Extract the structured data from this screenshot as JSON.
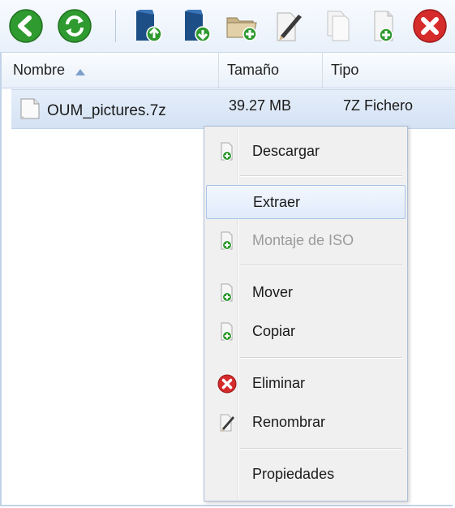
{
  "toolbar": {
    "buttons": [
      {
        "name": "back-button",
        "icon": "back-arrow-icon"
      },
      {
        "name": "refresh-button",
        "icon": "refresh-icon"
      },
      {
        "name": "upload-button",
        "icon": "upload-icon"
      },
      {
        "name": "download-button",
        "icon": "download-icon"
      },
      {
        "name": "new-folder-button",
        "icon": "new-folder-icon"
      },
      {
        "name": "rename-button",
        "icon": "rename-icon"
      },
      {
        "name": "copy-button",
        "icon": "copy-icon"
      },
      {
        "name": "new-file-button",
        "icon": "new-file-icon"
      },
      {
        "name": "delete-button",
        "icon": "delete-icon"
      }
    ]
  },
  "grid": {
    "columns": {
      "name": "Nombre",
      "size": "Tamaño",
      "type": "Tipo"
    },
    "sort_indicator": "ascending",
    "rows": [
      {
        "name": "OUM_pictures.7z",
        "size": "39.27 MB",
        "type": "7Z Fichero",
        "selected": true
      }
    ]
  },
  "context_menu": {
    "items": [
      {
        "label": "Descargar",
        "icon": "download-file-icon",
        "enabled": true
      },
      {
        "label": "Extraer",
        "icon": "",
        "enabled": true,
        "hovered": true
      },
      {
        "label": "Montaje de ISO",
        "icon": "mount-file-icon",
        "enabled": false
      },
      {
        "label": "Mover",
        "icon": "move-file-icon",
        "enabled": true
      },
      {
        "label": "Copiar",
        "icon": "copy-file-icon",
        "enabled": true
      },
      {
        "label": "Eliminar",
        "icon": "delete-icon",
        "enabled": true
      },
      {
        "label": "Renombrar",
        "icon": "rename-icon",
        "enabled": true
      },
      {
        "label": "Propiedades",
        "icon": "",
        "enabled": true
      }
    ]
  },
  "colors": {
    "accent_green": "#2f9a2f",
    "danger_red": "#d62b2b",
    "folder_blue": "#1d4f86",
    "selection_blue": "#d4e2f4"
  }
}
